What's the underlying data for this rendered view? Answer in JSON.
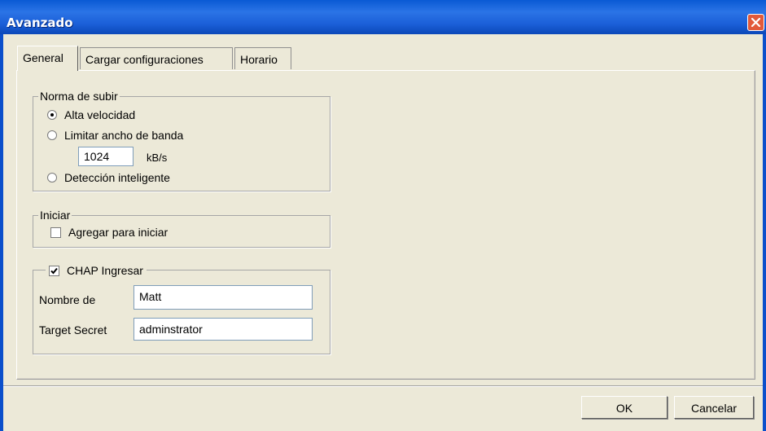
{
  "window": {
    "title": "Avanzado"
  },
  "tabs": [
    {
      "label": "General"
    },
    {
      "label": "Cargar configuraciones"
    },
    {
      "label": "Horario"
    }
  ],
  "upload_policy": {
    "legend": "Norma de subir",
    "options": [
      {
        "label": "Alta velocidad",
        "selected": true
      },
      {
        "label": "Limitar ancho de banda",
        "selected": false
      },
      {
        "label": "Detección inteligente",
        "selected": false
      }
    ],
    "bandwidth_value": "1024",
    "bandwidth_unit": "kB/s"
  },
  "startup": {
    "legend": "Iniciar",
    "add_to_startup_label": "Agregar para iniciar",
    "add_to_startup_checked": false
  },
  "chap": {
    "label": "CHAP Ingresar",
    "checked": true,
    "name_label": "Nombre de",
    "name_value": "Matt",
    "secret_label": "Target Secret",
    "secret_value": "adminstrator"
  },
  "buttons": {
    "ok": "OK",
    "cancel": "Cancelar"
  },
  "colors": {
    "title_bar": "#1b5fd8",
    "close_button": "#e25a3a",
    "dialog_bg": "#ece9d8"
  }
}
